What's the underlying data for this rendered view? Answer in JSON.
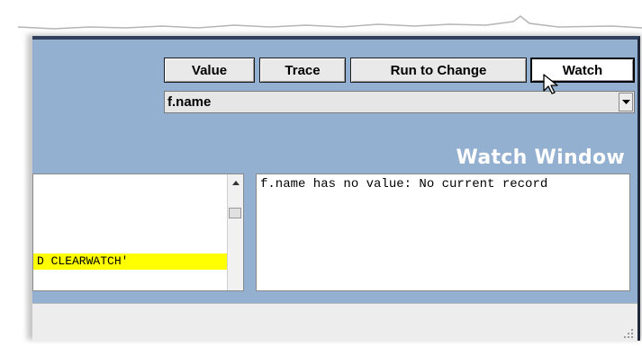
{
  "toolbar": {
    "value_label": "Value",
    "trace_label": "Trace",
    "run_to_change_label": "Run to Change",
    "watch_label": "Watch"
  },
  "expression_dropdown": {
    "selected": "f.name"
  },
  "watch_window": {
    "title": "Watch Window",
    "output": "f.name has no value: No current record"
  },
  "code_pane": {
    "highlighted_line": "D CLEARWATCH'"
  },
  "colors": {
    "panel_bg": "#94b0d1",
    "highlight": "#ffff00"
  }
}
